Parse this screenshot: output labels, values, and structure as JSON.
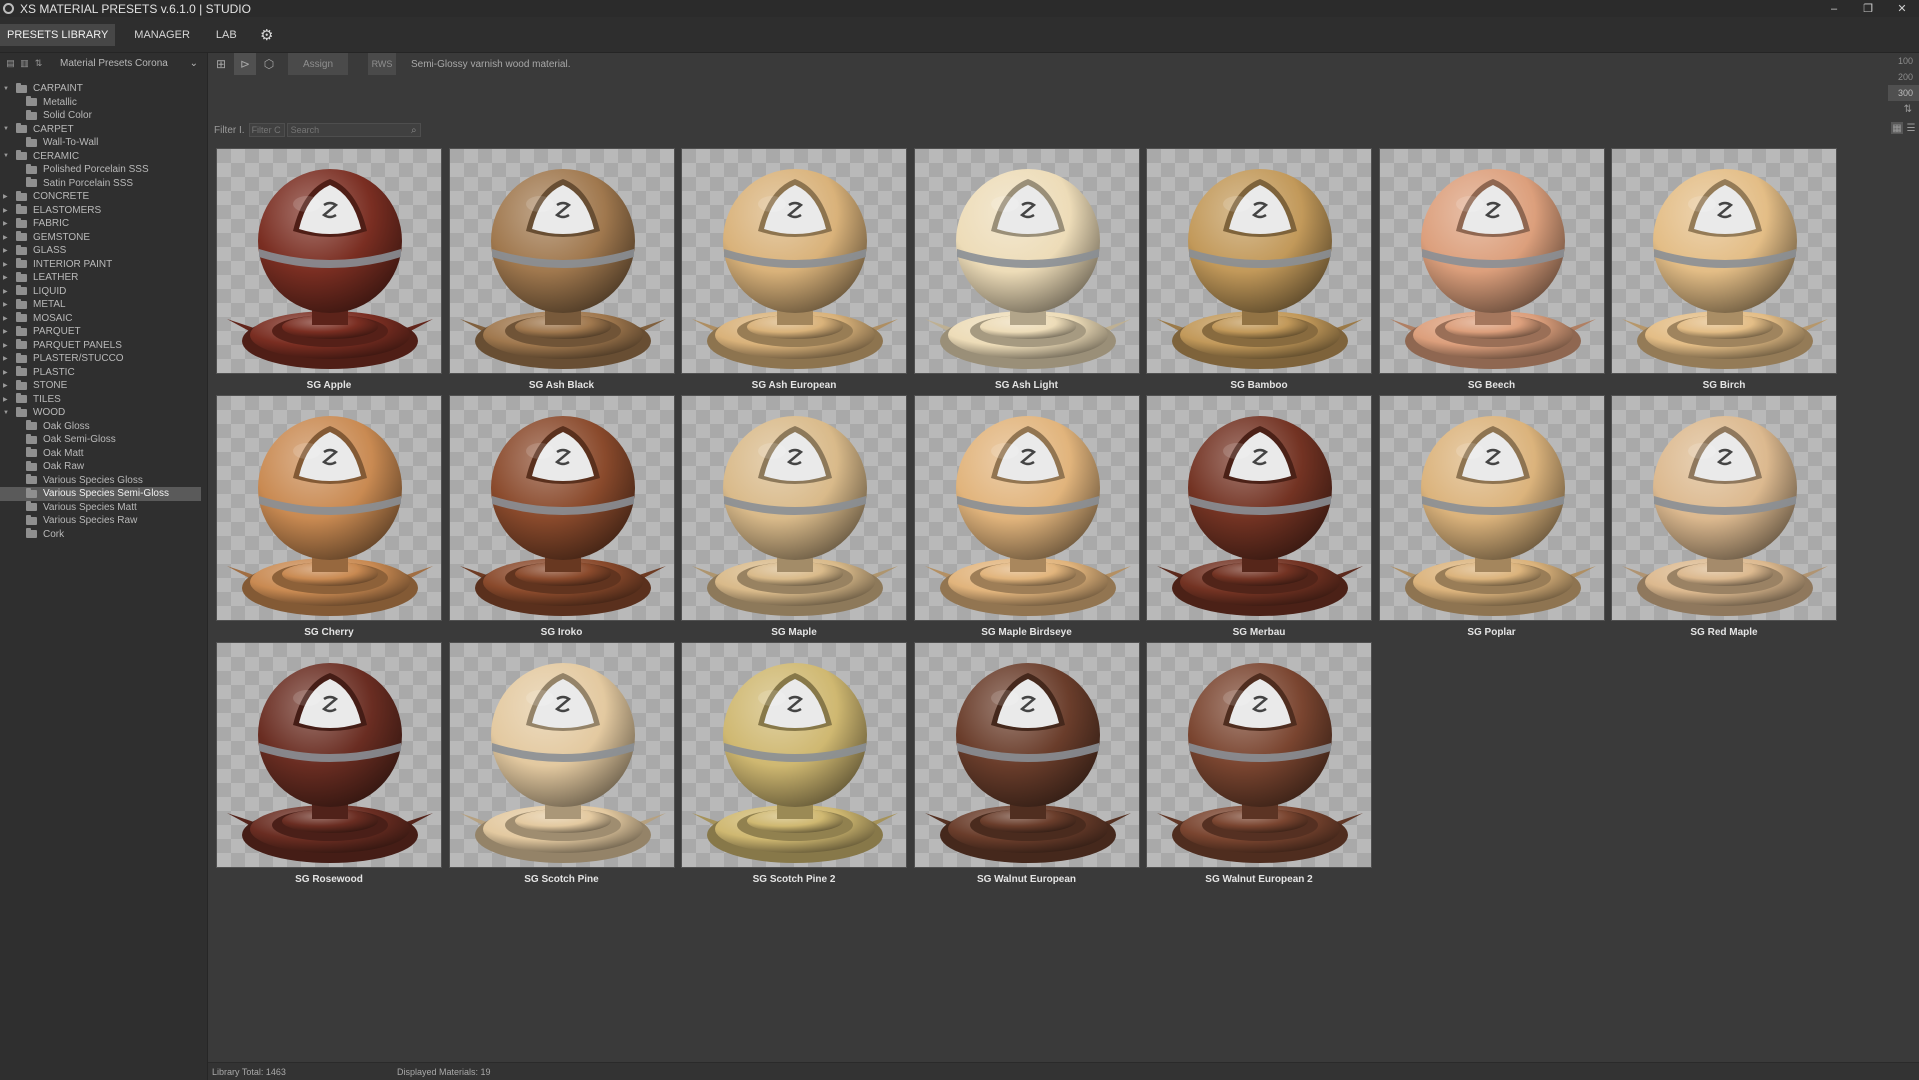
{
  "window": {
    "title": "XS MATERIAL PRESETS v.6.1.0 | STUDIO",
    "controls": {
      "minimize": "–",
      "restore": "❐",
      "close": "✕"
    }
  },
  "menu": {
    "tabs": [
      {
        "label": "PRESETS LIBRARY",
        "active": true
      },
      {
        "label": "MANAGER",
        "active": false
      },
      {
        "label": "LAB",
        "active": false
      }
    ]
  },
  "sidebar": {
    "library": "Material Presets Corona",
    "tree": [
      {
        "label": "CARPAINT",
        "expanded": true,
        "children": [
          "Metallic",
          "Solid Color"
        ]
      },
      {
        "label": "CARPET",
        "expanded": true,
        "children": [
          "Wall-To-Wall"
        ]
      },
      {
        "label": "CERAMIC",
        "expanded": true,
        "children": [
          "Polished Porcelain SSS",
          "Satin Porcelain SSS"
        ]
      },
      {
        "label": "CONCRETE",
        "expanded": false,
        "children": []
      },
      {
        "label": "ELASTOMERS",
        "expanded": false,
        "children": []
      },
      {
        "label": "FABRIC",
        "expanded": false,
        "children": []
      },
      {
        "label": "GEMSTONE",
        "expanded": false,
        "children": []
      },
      {
        "label": "GLASS",
        "expanded": false,
        "children": []
      },
      {
        "label": "INTERIOR PAINT",
        "expanded": false,
        "children": []
      },
      {
        "label": "LEATHER",
        "expanded": false,
        "children": []
      },
      {
        "label": "LIQUID",
        "expanded": false,
        "children": []
      },
      {
        "label": "METAL",
        "expanded": false,
        "children": []
      },
      {
        "label": "MOSAIC",
        "expanded": false,
        "children": []
      },
      {
        "label": "PARQUET",
        "expanded": false,
        "children": []
      },
      {
        "label": "PARQUET PANELS",
        "expanded": false,
        "children": []
      },
      {
        "label": "PLASTER/STUCCO",
        "expanded": false,
        "children": []
      },
      {
        "label": "PLASTIC",
        "expanded": false,
        "children": []
      },
      {
        "label": "STONE",
        "expanded": false,
        "children": []
      },
      {
        "label": "TILES",
        "expanded": false,
        "children": []
      },
      {
        "label": "WOOD",
        "expanded": true,
        "children": [
          "Oak Gloss",
          "Oak Semi-Gloss",
          "Oak Matt",
          "Oak Raw",
          "Various Species Gloss",
          "Various Species Semi-Gloss",
          "Various Species Matt",
          "Various Species Raw",
          "Cork"
        ]
      }
    ],
    "selected": "Various Species Semi-Gloss"
  },
  "toolbar": {
    "assign_label": "Assign",
    "rws_label": "RWS",
    "description": "Semi-Glossy varnish wood material."
  },
  "size_options": [
    "100",
    "200",
    "300"
  ],
  "size_selected": "300",
  "filter": {
    "label": "Filter I.",
    "field_placeholder": "Filter C",
    "search_placeholder": "Search"
  },
  "materials": [
    {
      "name": "SG Apple",
      "color": "#7a2e22"
    },
    {
      "name": "SG Ash Black",
      "color": "#a0784e"
    },
    {
      "name": "SG Ash European",
      "color": "#d9b27a"
    },
    {
      "name": "SG Ash Light",
      "color": "#eddcb8"
    },
    {
      "name": "SG Bamboo",
      "color": "#c2995a"
    },
    {
      "name": "SG Beech",
      "color": "#dc9f7c"
    },
    {
      "name": "SG Birch",
      "color": "#e3bd86"
    },
    {
      "name": "SG Cherry",
      "color": "#c98a52"
    },
    {
      "name": "SG Iroko",
      "color": "#8a4a2c"
    },
    {
      "name": "SG Maple",
      "color": "#d9ba8a"
    },
    {
      "name": "SG Maple Birdseye",
      "color": "#e1b47c"
    },
    {
      "name": "SG Merbau",
      "color": "#733323"
    },
    {
      "name": "SG Poplar",
      "color": "#dbb37c"
    },
    {
      "name": "SG Red Maple",
      "color": "#dcb98f"
    },
    {
      "name": "SG Rosewood",
      "color": "#6a2d22"
    },
    {
      "name": "SG Scotch Pine",
      "color": "#e3c9a0"
    },
    {
      "name": "SG Scotch Pine 2",
      "color": "#cfb871"
    },
    {
      "name": "SG Walnut European",
      "color": "#6a3d2b"
    },
    {
      "name": "SG Walnut European 2",
      "color": "#7a4530"
    }
  ],
  "status": {
    "total": "Library Total: 1463",
    "displayed": "Displayed Materials: 19"
  }
}
